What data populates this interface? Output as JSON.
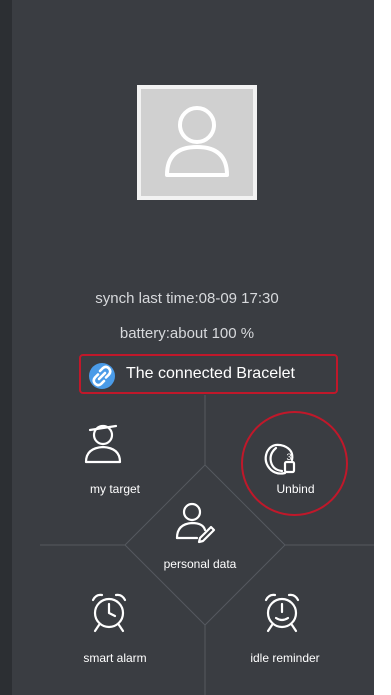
{
  "profile": {
    "avatar_icon": "user-silhouette-icon",
    "sync_text": "synch last time:08-09 17:30",
    "battery_text": "battery:about 100 %"
  },
  "bracelet": {
    "icon": "link-icon",
    "label": "The connected Bracelet"
  },
  "menu": {
    "my_target": {
      "label": "my target",
      "icon": "target-person-icon"
    },
    "unbind": {
      "label": "Unbind",
      "icon": "bracelet-unbind-icon"
    },
    "personal_data": {
      "label": "personal data",
      "icon": "person-edit-icon"
    },
    "smart_alarm": {
      "label": "smart alarm",
      "icon": "alarm-clock-icon"
    },
    "idle_reminder": {
      "label": "idle reminder",
      "icon": "idle-alarm-icon"
    }
  },
  "colors": {
    "background": "#3a3d42",
    "highlight_red": "#c0182a",
    "link_blue": "#4a9be8"
  }
}
